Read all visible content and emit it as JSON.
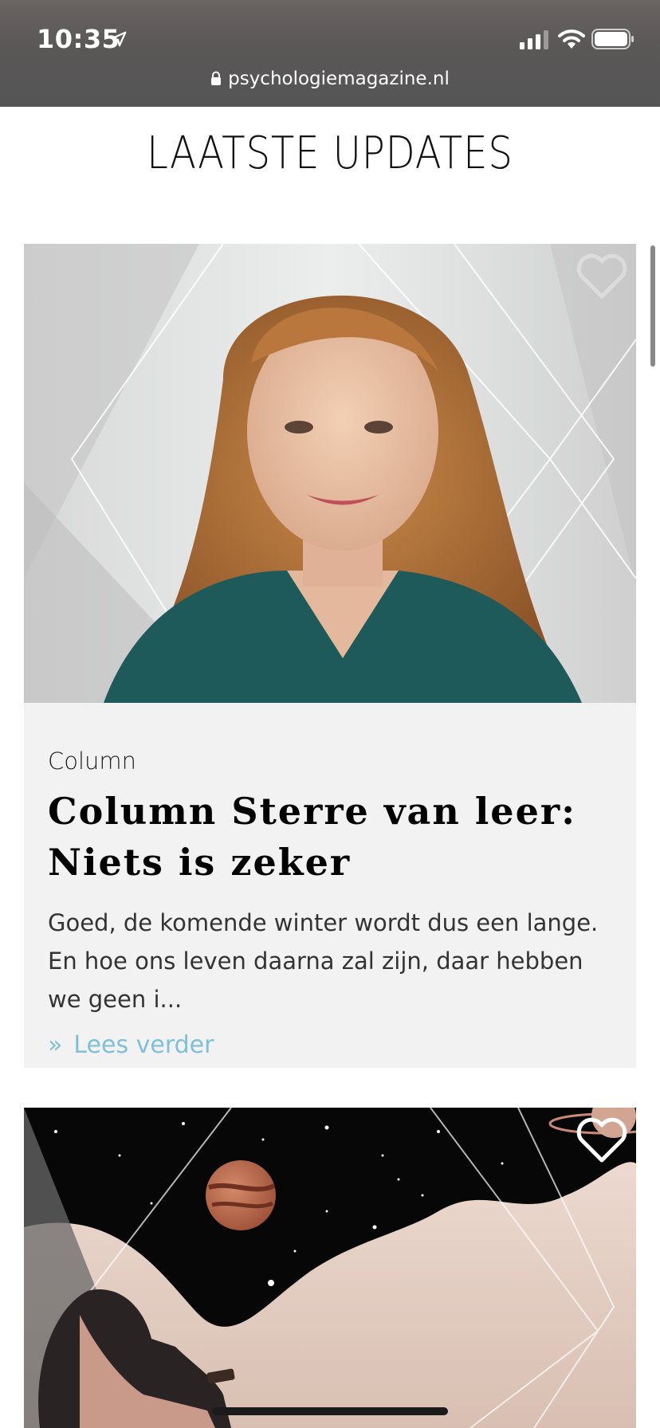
{
  "status_bar": {
    "time": "10:35",
    "url": "psychologiemagazine.nl"
  },
  "page": {
    "heading": "LAATSTE UPDATES"
  },
  "articles": [
    {
      "category": "Column",
      "title": "Column Sterre van leer: Niets is zeker",
      "excerpt": "Goed, de komende winter wordt dus een lange. En hoe ons leven daarna zal zijn, daar hebben we geen i...",
      "read_more_symbol": "»",
      "read_more": "Lees verder",
      "image_icon": "portrait-photo",
      "favorite_icon": "heart-icon"
    },
    {
      "image_icon": "space-illustration",
      "favorite_icon": "heart-icon"
    }
  ],
  "colors": {
    "link": "#7ec0d8",
    "card_background": "#f2f2f2",
    "status_bar": "#5a5757"
  }
}
